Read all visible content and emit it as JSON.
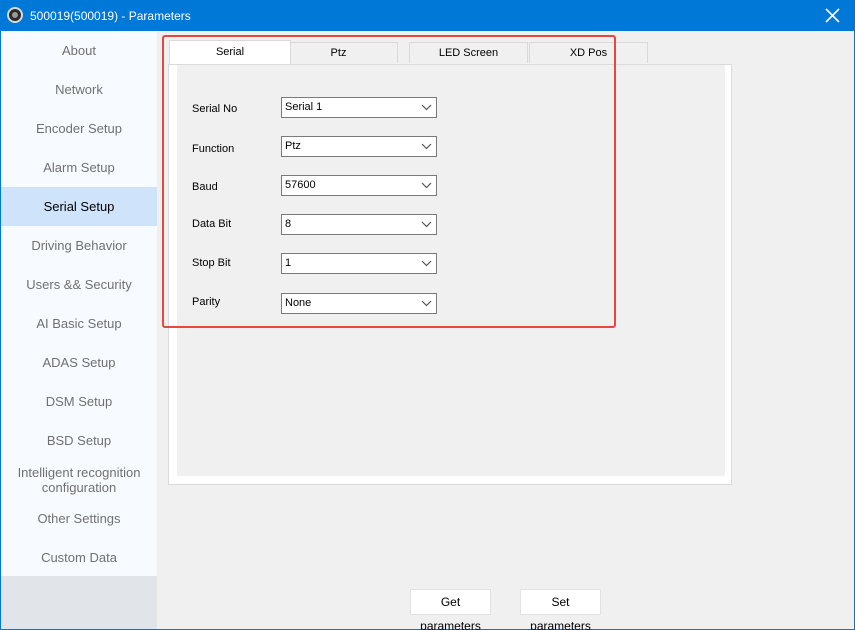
{
  "window": {
    "title": "500019(500019) - Parameters"
  },
  "sidebar": {
    "items": [
      {
        "label": "About"
      },
      {
        "label": "Network"
      },
      {
        "label": "Encoder Setup"
      },
      {
        "label": "Alarm Setup"
      },
      {
        "label": "Serial Setup"
      },
      {
        "label": "Driving Behavior"
      },
      {
        "label": "Users && Security"
      },
      {
        "label": "AI Basic Setup"
      },
      {
        "label": "ADAS Setup"
      },
      {
        "label": "DSM Setup"
      },
      {
        "label": "BSD Setup"
      },
      {
        "label": "Intelligent recognition configuration"
      },
      {
        "label": "Other Settings"
      },
      {
        "label": "Custom Data"
      }
    ],
    "active": "Serial Setup"
  },
  "tabs": [
    {
      "label": "Serial"
    },
    {
      "label": "Ptz"
    },
    {
      "label": "LED Screen"
    },
    {
      "label": "XD Pos"
    }
  ],
  "form": {
    "fields": [
      {
        "label": "Serial No",
        "value": "Serial 1"
      },
      {
        "label": "Function",
        "value": "Ptz"
      },
      {
        "label": "Baud",
        "value": "57600"
      },
      {
        "label": "Data Bit",
        "value": "8"
      },
      {
        "label": "Stop Bit",
        "value": "1"
      },
      {
        "label": "Parity",
        "value": "None"
      }
    ]
  },
  "buttons": {
    "get_label": "Get parameters",
    "set_label": "Set parameters"
  },
  "colors": {
    "titlebar": "#0078d7",
    "active_nav": "#cfe3fa",
    "highlight_border": "#e8473f"
  }
}
